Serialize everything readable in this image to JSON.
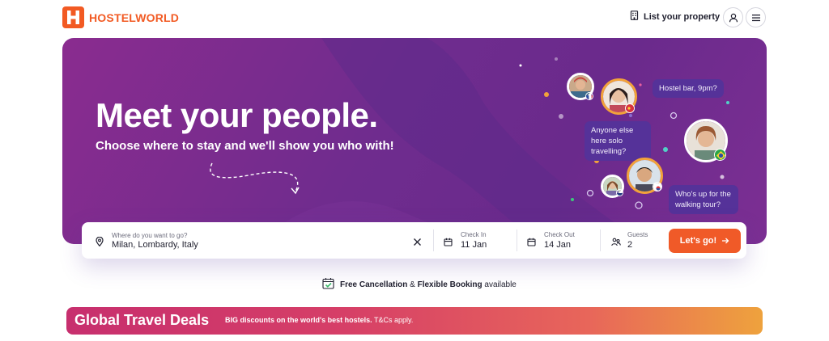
{
  "brand": {
    "name": "HOSTELWORLD",
    "color": "#f25a23"
  },
  "header": {
    "list_property": "List your property",
    "icons": [
      "building-icon",
      "user-icon",
      "hamburger-menu-icon"
    ]
  },
  "hero": {
    "title": "Meet your people.",
    "subtitle": "Choose where to stay and we'll show you who with!",
    "bubbles": [
      "Hostel bar, 9pm?",
      "Anyone else here solo travelling?",
      "Who's up for the walking tour?"
    ]
  },
  "search": {
    "destination": {
      "label": "Where do you want to go?",
      "value": "Milan,  Lombardy, Italy"
    },
    "checkin": {
      "label": "Check In",
      "value": "11 Jan"
    },
    "checkout": {
      "label": "Check Out",
      "value": "14 Jan"
    },
    "guests": {
      "label": "Guests",
      "value": "2"
    },
    "submit": "Let's go!"
  },
  "cancellation": {
    "part1": "Free Cancellation",
    "part2": " & ",
    "part3": "Flexible Booking",
    "part4": " available"
  },
  "deals": {
    "title": "Global Travel Deals",
    "bold": "BIG discounts on the world's best hostels.",
    "tc": " T&Cs apply."
  },
  "colors": {
    "hero": "#6f2c8e",
    "accent": "#f05a28",
    "bubble": "#553299"
  }
}
